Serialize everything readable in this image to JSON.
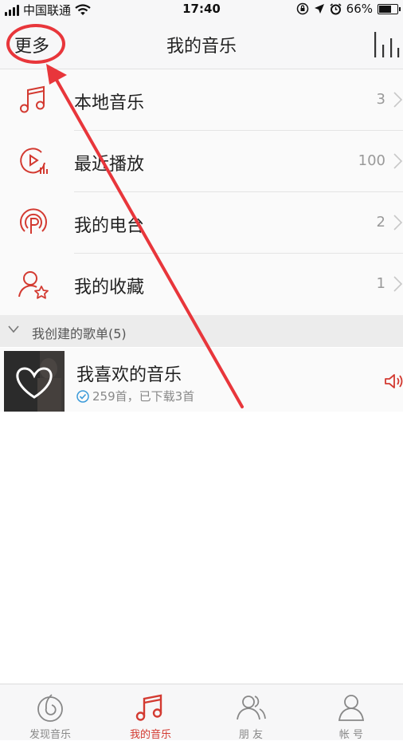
{
  "status_bar": {
    "carrier": "中国联通",
    "time": "17:40",
    "battery": "66%",
    "battery_level": 0.66
  },
  "navbar": {
    "more_label": "更多",
    "title": "我的音乐",
    "equalizer_icon": "equalizer-icon"
  },
  "menu": {
    "items": [
      {
        "label": "本地音乐",
        "count": "3",
        "icon": "music-note-icon"
      },
      {
        "label": "最近播放",
        "count": "100",
        "icon": "recent-play-icon"
      },
      {
        "label": "我的电台",
        "count": "2",
        "icon": "radio-icon"
      },
      {
        "label": "我的收藏",
        "count": "1",
        "icon": "favorite-user-icon"
      }
    ]
  },
  "section": {
    "label": "我创建的歌单(5)"
  },
  "playlist": {
    "title": "我喜欢的音乐",
    "subtitle": "259首，已下载3首",
    "icon": "heart-icon"
  },
  "tabs": [
    {
      "label": "发现音乐",
      "icon": "discover-icon",
      "active": false
    },
    {
      "label": "我的音乐",
      "icon": "music-note-icon",
      "active": true
    },
    {
      "label": "朋 友",
      "icon": "friends-icon",
      "active": false
    },
    {
      "label": "帐 号",
      "icon": "account-icon",
      "active": false
    }
  ],
  "colors": {
    "accent": "#d33a31",
    "annotation": "#e8363b"
  }
}
